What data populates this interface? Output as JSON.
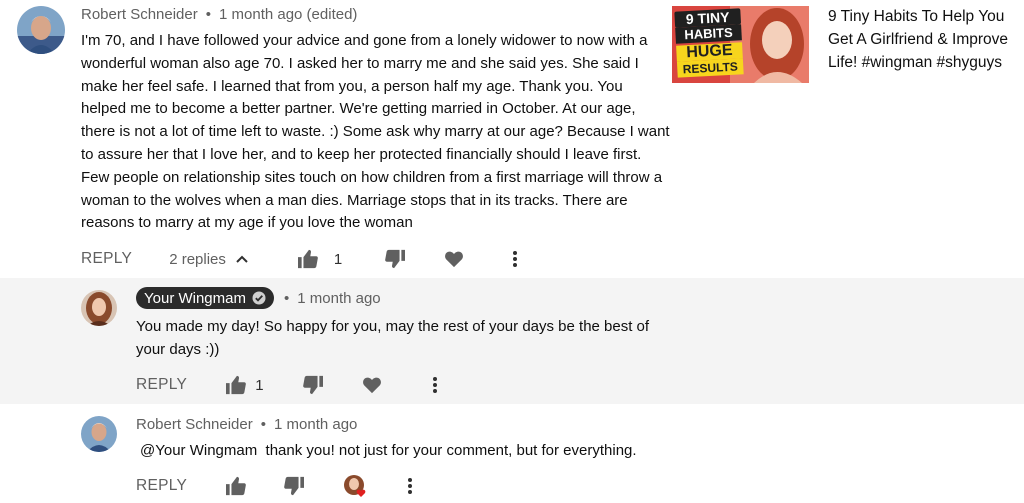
{
  "top_comment": {
    "author": "Robert Schneider",
    "separator": "•",
    "time": "1 month ago (edited)",
    "text": "I'm 70, and I have followed your advice and gone from a lonely widower to now with a wonderful woman also age 70. I asked her to marry me and she said yes. She said I make her feel safe. I learned that from you, a person half my age. Thank you. You helped me to become a better partner. We're getting married in October. At our age, there is not a lot of time left to waste. :) Some ask why marry at our age? Because I want to assure her that I love her, and to keep her protected financially should I leave first. Few people on relationship sites touch on how children from a first marriage will throw a woman to the wolves when a man dies. Marriage stops that in its tracks. There are reasons to marry at my age if you love the woman",
    "reply_label": "REPLY",
    "replies_label": "2 replies",
    "like_count": "1"
  },
  "reply1": {
    "author": "Your Wingmam",
    "separator": "•",
    "time": "1 month ago",
    "text": "You made my day! So happy for you, may the rest of your days be the best of your days :))",
    "reply_label": "REPLY",
    "like_count": "1"
  },
  "reply2": {
    "author": "Robert Schneider",
    "separator": "•",
    "time": "1 month ago",
    "text": "@Your Wingmam  thank you! not just for your comment, but for everything.",
    "reply_label": "REPLY"
  },
  "video": {
    "title": "9 Tiny Habits To Help You Get A Girlfriend & Improve Life! #wingman #shyguys",
    "thumb_line1": "9 TINY",
    "thumb_line2": "HABITS",
    "thumb_line3": "HUGE",
    "thumb_line4": "RESULTS"
  },
  "colors": {
    "accent_yellow": "#f7d51d",
    "heart_red": "#e02020",
    "reply_bg": "#f4f4f4"
  },
  "icons": [
    "thumb-up-icon",
    "thumb-down-icon",
    "heart-icon",
    "more-vert-icon",
    "verified-check-icon",
    "chevron-up-icon",
    "creator-heart-badge-icon"
  ]
}
